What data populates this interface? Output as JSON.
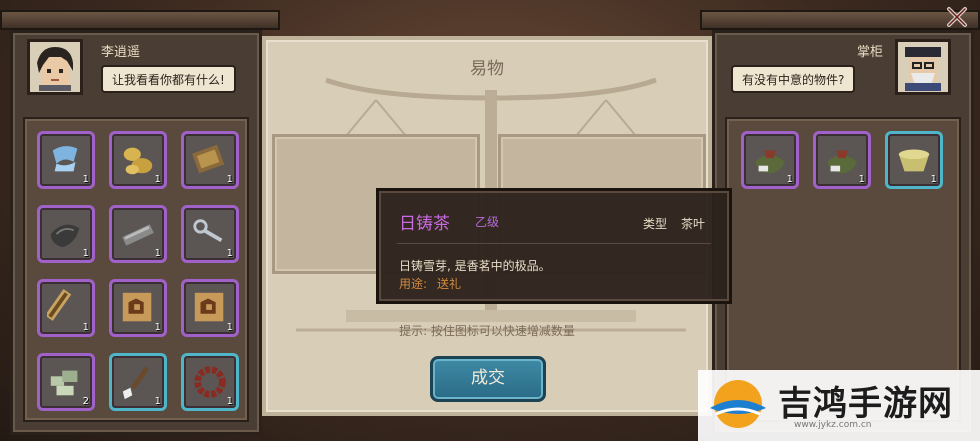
{
  "left_npc": {
    "name": "李逍遥",
    "speech": "让我看看你都有什么!"
  },
  "right_npc": {
    "name": "掌柜",
    "speech": "有没有中意的物件?"
  },
  "center": {
    "title": "易物",
    "hint": "提示: 按住图标可以快速增减数量",
    "trade_button": "成交"
  },
  "tooltip": {
    "item_name": "日铸茶",
    "grade": "乙级",
    "type_label": "类型",
    "type_value": "茶叶",
    "description": "日铸雪芽, 是香茗中的极品。",
    "use_label": "用途:",
    "use_value": "送礼"
  },
  "player_items": [
    {
      "icon": "cloth-icon",
      "count": "1",
      "frame": "purple"
    },
    {
      "icon": "gold-ingot-icon",
      "count": "1",
      "frame": "purple"
    },
    {
      "icon": "scroll-box-icon",
      "count": "1",
      "frame": "purple"
    },
    {
      "icon": "black-pouch-icon",
      "count": "1",
      "frame": "purple"
    },
    {
      "icon": "iron-bar-icon",
      "count": "1",
      "frame": "purple"
    },
    {
      "icon": "key-icon",
      "count": "1",
      "frame": "purple"
    },
    {
      "icon": "bamboo-scroll-icon",
      "count": "1",
      "frame": "purple"
    },
    {
      "icon": "map-icon",
      "count": "1",
      "frame": "purple"
    },
    {
      "icon": "map-icon",
      "count": "1",
      "frame": "purple"
    },
    {
      "icon": "jade-pieces-icon",
      "count": "2",
      "frame": "purple"
    },
    {
      "icon": "brush-icon",
      "count": "1",
      "frame": "blue"
    },
    {
      "icon": "prayer-beads-icon",
      "count": "1",
      "frame": "blue"
    }
  ],
  "merchant_items": [
    {
      "icon": "tea-bundle-icon",
      "count": "1",
      "frame": "purple"
    },
    {
      "icon": "tea-bundle-icon",
      "count": "1",
      "frame": "purple"
    },
    {
      "icon": "tea-bowl-icon",
      "count": "1",
      "frame": "blue"
    }
  ],
  "watermark": {
    "text": "吉鸿手游网",
    "url": "www.jykz.com.cn"
  },
  "colors": {
    "frame_purple": "#a062c8",
    "frame_blue": "#4fb5c8",
    "tooltip_name": "#c86ae0",
    "use_text": "#d48a3c",
    "trade_button": "#2a6b86"
  }
}
